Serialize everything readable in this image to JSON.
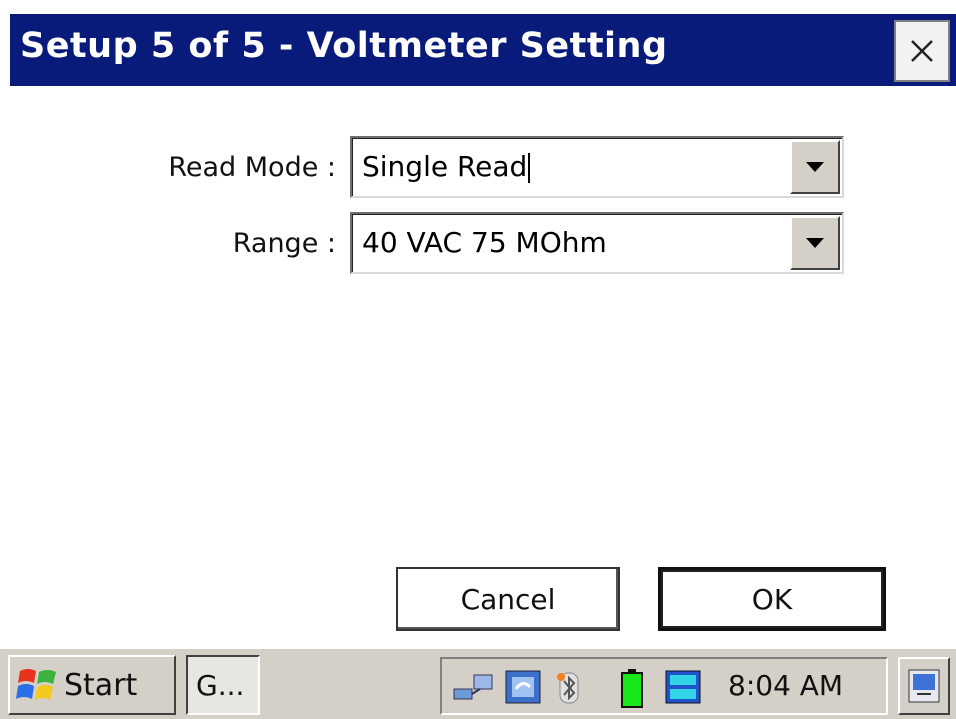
{
  "window": {
    "title": "Setup 5 of 5 - Voltmeter Setting",
    "close_icon": "close-icon",
    "titlebar_color": "#081a7a"
  },
  "form": {
    "read_mode_label": "Read Mode :",
    "read_mode_value": "Single Read",
    "range_label": "Range :",
    "range_value": "40 VAC 75 MOhm",
    "dropdown_icon": "chevron-down-icon"
  },
  "buttons": {
    "cancel": "Cancel",
    "ok": "OK"
  },
  "taskbar": {
    "start_label": "Start",
    "task_label": "G...",
    "clock": "8:04 AM",
    "tray_icons": [
      "network-icon",
      "sync-icon",
      "bluetooth-icon",
      "battery-icon",
      "client-icon"
    ],
    "battery_color": "#17e817"
  }
}
